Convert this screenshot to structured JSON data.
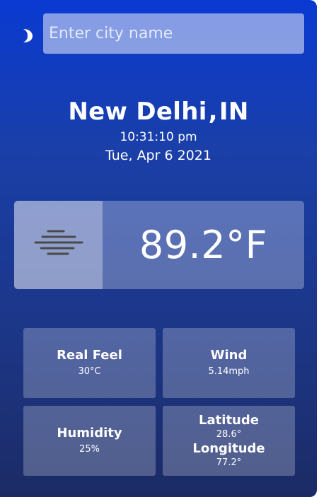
{
  "theme_toggle": {
    "icon": "moon-icon"
  },
  "search": {
    "placeholder": "Enter city name",
    "value": ""
  },
  "location": {
    "city": "New Delhi",
    "separator": ",",
    "country": "IN"
  },
  "datetime": {
    "time": "10:31:10 pm",
    "date": "Tue, Apr 6 2021"
  },
  "current": {
    "condition_icon": "haze-icon",
    "temperature": "89.2°F"
  },
  "details": {
    "real_feel": {
      "label": "Real Feel",
      "value": "30°C"
    },
    "wind": {
      "label": "Wind",
      "value": "5.14mph"
    },
    "humidity": {
      "label": "Humidity",
      "value": "25%"
    },
    "latitude": {
      "label": "Latitude",
      "value": "28.6°"
    },
    "longitude": {
      "label": "Longitude",
      "value": "77.2°"
    }
  },
  "colors": {
    "gradient_top": "#0a3ad2",
    "gradient_bottom": "#1c2b65",
    "text": "#ffffff"
  }
}
